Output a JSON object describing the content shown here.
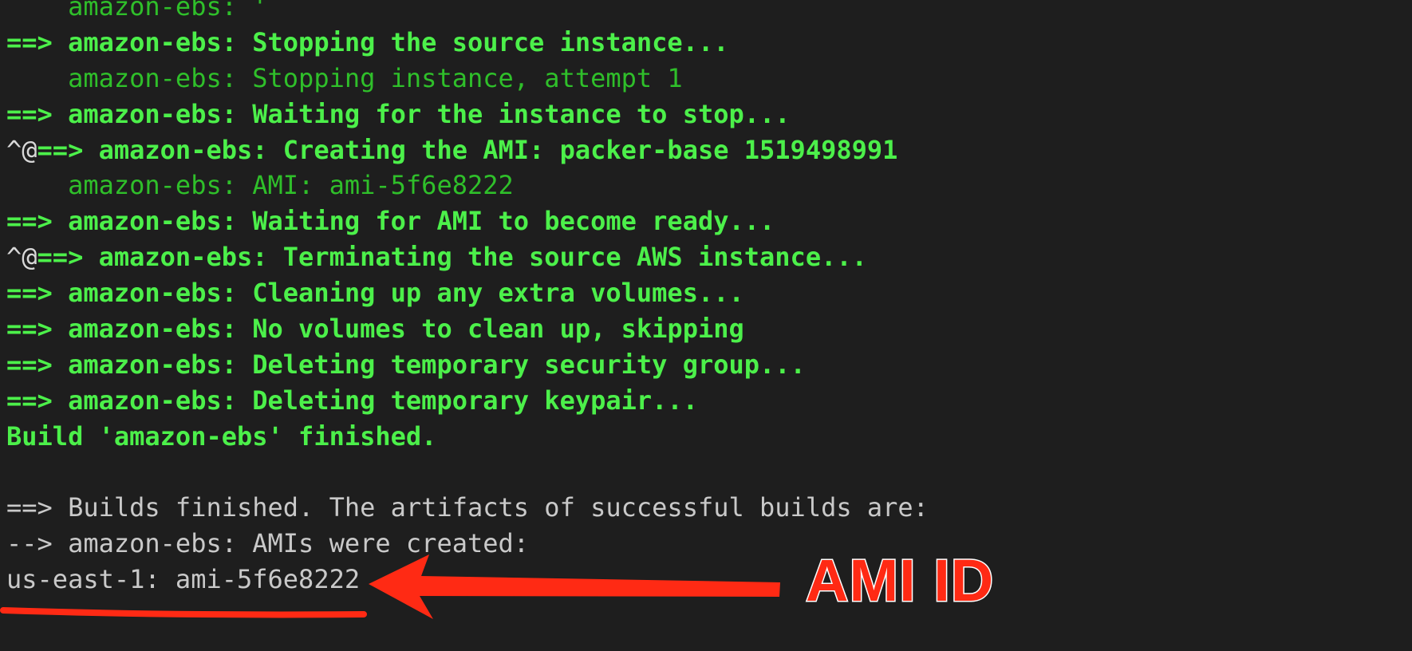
{
  "terminal": {
    "lines": [
      {
        "style": "green",
        "text": "    amazon-ebs: '"
      },
      {
        "style": "bold-green",
        "text": "==> amazon-ebs: Stopping the source instance..."
      },
      {
        "style": "green",
        "text": "    amazon-ebs: Stopping instance, attempt 1"
      },
      {
        "style": "bold-green",
        "text": "==> amazon-ebs: Waiting for the instance to stop..."
      },
      {
        "style": "bold-green",
        "prefix": "^@",
        "text": "==> amazon-ebs: Creating the AMI: packer-base 1519498991"
      },
      {
        "style": "green",
        "text": "    amazon-ebs: AMI: ami-5f6e8222"
      },
      {
        "style": "bold-green",
        "text": "==> amazon-ebs: Waiting for AMI to become ready..."
      },
      {
        "style": "bold-green",
        "prefix": "^@",
        "text": "==> amazon-ebs: Terminating the source AWS instance..."
      },
      {
        "style": "bold-green",
        "text": "==> amazon-ebs: Cleaning up any extra volumes..."
      },
      {
        "style": "bold-green",
        "text": "==> amazon-ebs: No volumes to clean up, skipping"
      },
      {
        "style": "bold-green",
        "text": "==> amazon-ebs: Deleting temporary security group..."
      },
      {
        "style": "bold-green",
        "text": "==> amazon-ebs: Deleting temporary keypair..."
      },
      {
        "style": "bold-green",
        "text": "Build 'amazon-ebs' finished."
      },
      {
        "style": "grey",
        "text": ""
      },
      {
        "style": "grey",
        "text": "==> Builds finished. The artifacts of successful builds are:"
      },
      {
        "style": "grey",
        "text": "--> amazon-ebs: AMIs were created:"
      },
      {
        "style": "grey",
        "text": "us-east-1: ami-5f6e8222"
      }
    ]
  },
  "annotation": {
    "label": "AMI ID",
    "color": "#ff2a14"
  },
  "colors": {
    "background": "#1e1e1e",
    "bold_green": "#4cf04a",
    "green": "#2fbf2a",
    "grey": "#c9c9c9"
  }
}
